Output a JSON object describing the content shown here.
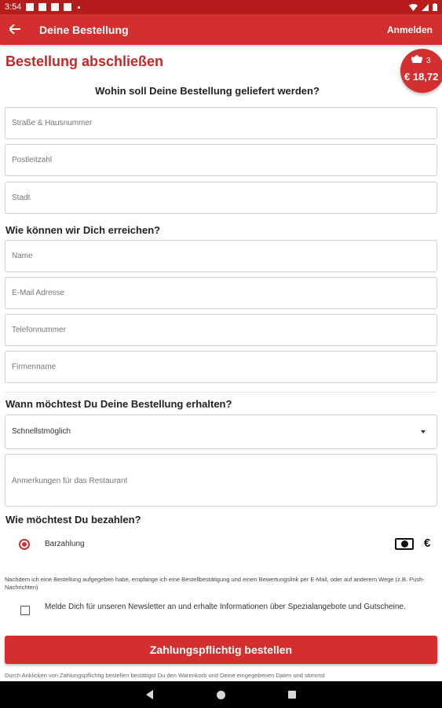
{
  "statusbar": {
    "time": "3:54"
  },
  "appbar": {
    "title": "Deine Bestellung",
    "login": "Anmelden"
  },
  "cart": {
    "count": "3",
    "total": "€ 18,72"
  },
  "page_title": "Bestellung abschließen",
  "delivery": {
    "heading": "Wohin soll Deine Bestellung geliefert werden?",
    "street_placeholder": "Straße & Hausnummer",
    "zip_placeholder": "Postleitzahl",
    "city_placeholder": "Stadt"
  },
  "contact": {
    "heading": "Wie können wir Dich erreichen?",
    "name_placeholder": "Name",
    "email_placeholder": "E-Mail Adresse",
    "phone_placeholder": "Telefonnummer",
    "company_placeholder": "Firmenname"
  },
  "timing": {
    "heading": "Wann möchtest Du Deine Bestellung erhalten?",
    "selected": "Schnellstmöglich",
    "notes_placeholder": "Anmerkungen für das Restaurant"
  },
  "payment": {
    "heading": "Wie möchtest Du bezahlen?",
    "option": "Barzahlung",
    "euro_symbol": "€"
  },
  "confirmation_note": "Nachdem ich eine Bestellung aufgegeben habe, empfange ich eine Bestellbestätigung und einen Bewertungslink per E-Mail, oder auf anderem Wege (z.B. Push-Nachrichten)",
  "newsletter_label": "Melde Dich für unseren Newsletter an und erhalte Informationen über Spezialangebote und Gutscheine.",
  "order_button": "Zahlungspflichtig bestellen",
  "legal_text": "Durch Anklicken von Zahlungspflichtig bestellen bestätigst Du den Warenkorb und Deine eingegebenen Daten und stimmst",
  "colors": {
    "brand": "#d32f2f",
    "statusbar": "#b71c1c"
  }
}
